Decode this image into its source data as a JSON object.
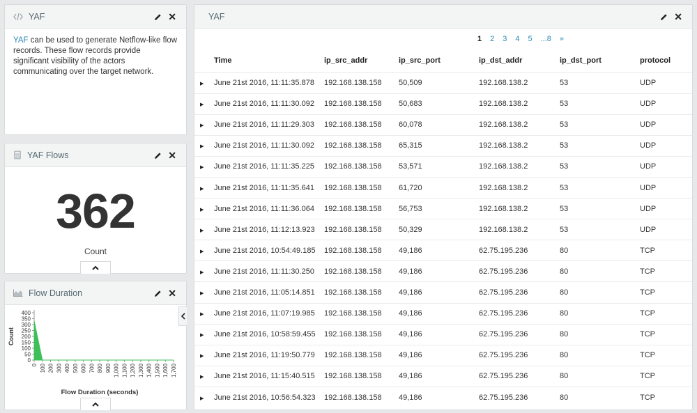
{
  "panels": {
    "yaf_text": {
      "title": "YAF",
      "link_text": "YAF",
      "description": " can be used to generate Netflow-like flow records. These flow records provide significant visibility of the actors communicating over the target network."
    },
    "yaf_flows": {
      "title": "YAF Flows",
      "count": "362",
      "count_label": "Count"
    },
    "flow_duration": {
      "title": "Flow Duration",
      "chart_data": {
        "type": "area",
        "xlabel": "Flow Duration (seconds)",
        "ylabel": "Count",
        "ylim": [
          0,
          400
        ],
        "y_ticks": [
          "0",
          "50",
          "100",
          "150",
          "200",
          "250",
          "300",
          "350",
          "400"
        ],
        "x_ticks": [
          "0",
          "100",
          "200",
          "300",
          "400",
          "500",
          "600",
          "700",
          "800",
          "900",
          "1,000",
          "1,100",
          "1,200",
          "1,300",
          "1,400",
          "1,500",
          "1,600",
          "1,700"
        ],
        "x": [
          0,
          100,
          1700
        ],
        "values": [
          330,
          0,
          0
        ],
        "color": "#3fbf5a"
      }
    },
    "table": {
      "title": "YAF",
      "pagination": [
        "1",
        "2",
        "3",
        "4",
        "5",
        "...8",
        "»"
      ],
      "current_page": "1",
      "columns": [
        "Time",
        "ip_src_addr",
        "ip_src_port",
        "ip_dst_addr",
        "ip_dst_port",
        "protocol"
      ],
      "rows": [
        [
          "June 21st 2016, 11:11:35.878",
          "192.168.138.158",
          "50,509",
          "192.168.138.2",
          "53",
          "UDP"
        ],
        [
          "June 21st 2016, 11:11:30.092",
          "192.168.138.158",
          "50,683",
          "192.168.138.2",
          "53",
          "UDP"
        ],
        [
          "June 21st 2016, 11:11:29.303",
          "192.168.138.158",
          "60,078",
          "192.168.138.2",
          "53",
          "UDP"
        ],
        [
          "June 21st 2016, 11:11:30.092",
          "192.168.138.158",
          "65,315",
          "192.168.138.2",
          "53",
          "UDP"
        ],
        [
          "June 21st 2016, 11:11:35.225",
          "192.168.138.158",
          "53,571",
          "192.168.138.2",
          "53",
          "UDP"
        ],
        [
          "June 21st 2016, 11:11:35.641",
          "192.168.138.158",
          "61,720",
          "192.168.138.2",
          "53",
          "UDP"
        ],
        [
          "June 21st 2016, 11:11:36.064",
          "192.168.138.158",
          "56,753",
          "192.168.138.2",
          "53",
          "UDP"
        ],
        [
          "June 21st 2016, 11:12:13.923",
          "192.168.138.158",
          "50,329",
          "192.168.138.2",
          "53",
          "UDP"
        ],
        [
          "June 21st 2016, 10:54:49.185",
          "192.168.138.158",
          "49,186",
          "62.75.195.236",
          "80",
          "TCP"
        ],
        [
          "June 21st 2016, 11:11:30.250",
          "192.168.138.158",
          "49,186",
          "62.75.195.236",
          "80",
          "TCP"
        ],
        [
          "June 21st 2016, 11:05:14.851",
          "192.168.138.158",
          "49,186",
          "62.75.195.236",
          "80",
          "TCP"
        ],
        [
          "June 21st 2016, 11:07:19.985",
          "192.168.138.158",
          "49,186",
          "62.75.195.236",
          "80",
          "TCP"
        ],
        [
          "June 21st 2016, 10:58:59.455",
          "192.168.138.158",
          "49,186",
          "62.75.195.236",
          "80",
          "TCP"
        ],
        [
          "June 21st 2016, 11:19:50.779",
          "192.168.138.158",
          "49,186",
          "62.75.195.236",
          "80",
          "TCP"
        ],
        [
          "June 21st 2016, 11:15:40.515",
          "192.168.138.158",
          "49,186",
          "62.75.195.236",
          "80",
          "TCP"
        ],
        [
          "June 21st 2016, 10:56:54.323",
          "192.168.138.158",
          "49,186",
          "62.75.195.236",
          "80",
          "TCP"
        ]
      ]
    }
  },
  "icons": {
    "code": "code-icon",
    "calculator": "calculator-icon",
    "area_chart": "area-chart-icon",
    "edit": "pencil-icon",
    "close": "close-icon",
    "collapse": "chevron-up-icon",
    "side": "chevron-left-icon",
    "expand": "caret-right-icon"
  }
}
